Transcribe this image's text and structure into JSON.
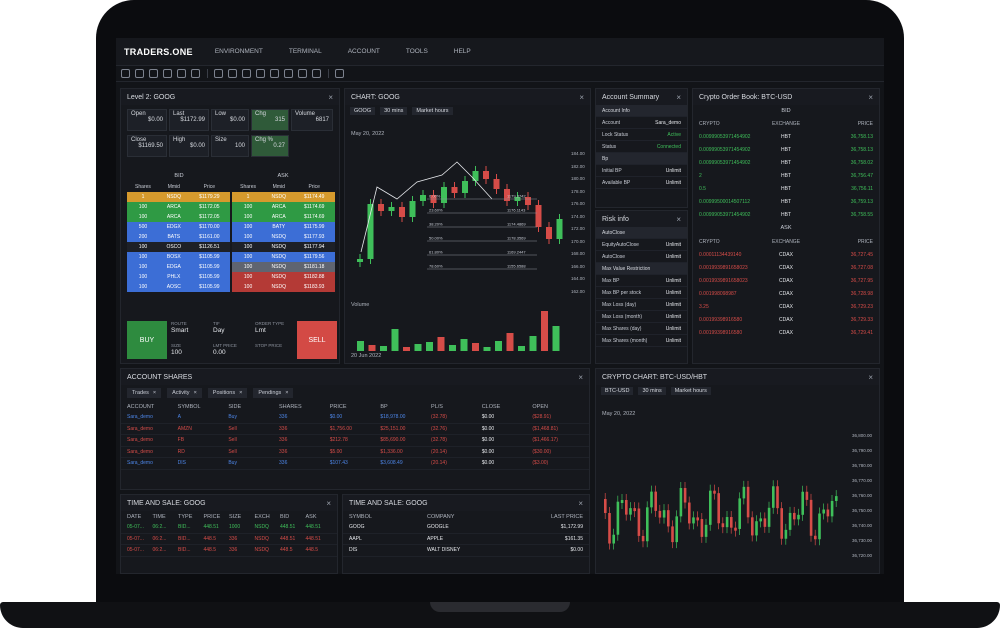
{
  "app": {
    "brand": "TRADERS.ONE",
    "nav": [
      "ENVIRONMENT",
      "TERMINAL",
      "ACCOUNT",
      "TOOLS",
      "HELP"
    ]
  },
  "level2": {
    "title": "Level 2: GOOG",
    "cells": [
      {
        "label": "Open",
        "value": "$0.00"
      },
      {
        "label": "Last",
        "value": "$1172.99"
      },
      {
        "label": "Low",
        "value": "$0.00"
      },
      {
        "label": "Chg",
        "value": "315"
      },
      {
        "label": "Volume",
        "value": "6817"
      },
      {
        "label": "Close",
        "value": "$1169.50"
      },
      {
        "label": "High",
        "value": "$0.00"
      },
      {
        "label": "Size",
        "value": "100"
      },
      {
        "label": "Chg %",
        "value": "0.27"
      }
    ],
    "bid_title": "BID",
    "ask_title": "ASK",
    "cols": [
      "Shares",
      "Mmid",
      "Price"
    ],
    "bids": [
      [
        "1",
        "NSDQ",
        "$1179.29",
        "orange"
      ],
      [
        "100",
        "ARCA",
        "$1172.05",
        "green"
      ],
      [
        "100",
        "ARCA",
        "$1172.05",
        "green"
      ],
      [
        "500",
        "EDGX",
        "$1170.00",
        "blue"
      ],
      [
        "200",
        "BATS",
        "$1161.00",
        "blue"
      ],
      [
        "100",
        "OSCO",
        "$1126.51",
        "dark"
      ],
      [
        "100",
        "BOSX",
        "$1105.99",
        "blue"
      ],
      [
        "100",
        "EDGA",
        "$1105.99",
        "blue"
      ],
      [
        "100",
        "PHLX",
        "$1105.99",
        "blue"
      ],
      [
        "100",
        "AOSC",
        "$1105.99",
        "blue"
      ]
    ],
    "asks": [
      [
        "1",
        "NSDQ",
        "$1174.49",
        "orange"
      ],
      [
        "100",
        "ARCA",
        "$1174.69",
        "green"
      ],
      [
        "100",
        "ARCA",
        "$1174.69",
        "green"
      ],
      [
        "100",
        "BATY",
        "$1175.99",
        "blue"
      ],
      [
        "100",
        "NSDQ",
        "$1177.93",
        "blue"
      ],
      [
        "100",
        "NSDQ",
        "$1177.94",
        "dark"
      ],
      [
        "100",
        "NSDQ",
        "$1179.56",
        "blue"
      ],
      [
        "100",
        "NSDQ",
        "$1181.18",
        "gray"
      ],
      [
        "100",
        "NSDQ",
        "$1182.88",
        "red"
      ],
      [
        "100",
        "NSDQ",
        "$1183.93",
        "red"
      ]
    ],
    "buy": "BUY",
    "sell": "SELL",
    "route_label": "ROUTE",
    "route": "Smart",
    "tif_label": "TIF",
    "tif": "Day",
    "order_label": "ORDER TYPE",
    "order": "Lmt",
    "size_label": "SIZE",
    "size": "100",
    "lmt_label": "LMT PRICE",
    "lmt": "0.00",
    "stop_label": "STOP PRICE",
    "stop": ""
  },
  "chart": {
    "title": "CHART: GOOG",
    "symbol": "GOOG",
    "interval": "30 mins",
    "session": "Market hours",
    "ohlc": "May 20, 2022",
    "volume_label": "Volume",
    "date": "20 Jun 2022",
    "price_ticks": [
      "184.00",
      "182.00",
      "180.00",
      "178.00",
      "176.00",
      "174.00",
      "172.00",
      "170.00",
      "168.00",
      "166.00",
      "164.00",
      "162.00"
    ],
    "fib": [
      [
        "0.00%",
        "1179.3742"
      ],
      [
        "23.60%",
        "1176.1143"
      ],
      [
        "38.20%",
        "1174.4869"
      ],
      [
        "50.00%",
        "1178.3569"
      ],
      [
        "61.80%",
        "1169.2447"
      ],
      [
        "78.60%",
        "1155.6588"
      ]
    ]
  },
  "summary": {
    "title": "Account Summary",
    "rows": [
      {
        "k": "Account Info",
        "v": "",
        "hdr": true
      },
      {
        "k": "Account",
        "v": "Sara_demo",
        "c": "white"
      },
      {
        "k": "Lock Status",
        "v": "Active",
        "c": "green"
      },
      {
        "k": "Status",
        "v": "Connected",
        "c": "green"
      },
      {
        "k": "Bp",
        "v": "",
        "hdr": true
      },
      {
        "k": "Initial BP",
        "v": "Unlimit",
        "c": "white"
      },
      {
        "k": "Available BP",
        "v": "Unlimit",
        "c": "white"
      }
    ]
  },
  "risk": {
    "title": "Risk info",
    "rows": [
      {
        "k": "AutoClose",
        "v": "",
        "hdr": true
      },
      {
        "k": "EquityAutoClose",
        "v": "Unlimit"
      },
      {
        "k": "AutoClose",
        "v": "Unlimit"
      },
      {
        "k": "Max Value Restriction",
        "v": "",
        "hdr": true
      },
      {
        "k": "Max BP",
        "v": "Unlimit"
      },
      {
        "k": "Max BP per stock",
        "v": "Unlimit"
      },
      {
        "k": "Max Loss (day)",
        "v": "Unlimit"
      },
      {
        "k": "Max Loss (month)",
        "v": "Unlimit"
      },
      {
        "k": "Max Shares (day)",
        "v": "Unlimit"
      },
      {
        "k": "Max Shares (month)",
        "v": "Unlimit"
      }
    ]
  },
  "orderbook": {
    "title": "Crypto Order Book: BTC-USD",
    "bid": "BID",
    "ask": "ASK",
    "cols": [
      "CRYPTO",
      "EXCHANGE",
      "PRICE"
    ],
    "bids": [
      [
        "0.00999053971454902",
        "HBT",
        "36,758.13"
      ],
      [
        "0.00999053971454902",
        "HBT",
        "36,758.13"
      ],
      [
        "0.00999053971454902",
        "HBT",
        "36,758.02"
      ],
      [
        "2",
        "HBT",
        "36,756.47"
      ],
      [
        "0.5",
        "HBT",
        "36,756.11"
      ],
      [
        "0.00999500014507112",
        "HBT",
        "36,759.13"
      ],
      [
        "0.00999053971454902",
        "HBT",
        "36,758.55"
      ]
    ],
    "asks": [
      [
        "0.00011134439140",
        "CDAX",
        "36,727.45"
      ],
      [
        "0.0019939891658023",
        "CDAX",
        "36,727.08"
      ],
      [
        "0.0019939891658023",
        "CDAX",
        "36,727.95"
      ],
      [
        "0.001998098987",
        "CDAX",
        "36,728.98"
      ],
      [
        "3.25",
        "CDAX",
        "36,729.23"
      ],
      [
        "0.00199398916580",
        "CDAX",
        "36,729.33"
      ],
      [
        "0.00199398916580",
        "CDAX",
        "36,729.41"
      ]
    ]
  },
  "shares": {
    "title": "ACCOUNT SHARES",
    "tabs": [
      "Trades",
      "Activity",
      "Positions",
      "Pendings"
    ],
    "cols": [
      "ACCOUNT",
      "SYMBOL",
      "SIDE",
      "SHARES",
      "PRICE",
      "BP",
      "PL/S",
      "CLOSE",
      "OPEN"
    ],
    "rows": [
      [
        "Sara_demo",
        "A",
        "Buy",
        "336",
        "$0.00",
        "$18,978.00",
        "(32.78)",
        "$0.00",
        "($28.91)",
        "blue"
      ],
      [
        "Sara_demo",
        "AMZN",
        "Sell",
        "336",
        "$1,756.00",
        "$25,151.00",
        "(32.76)",
        "$0.00",
        "($1,468.81)",
        "red"
      ],
      [
        "Sara_demo",
        "FB",
        "Sell",
        "336",
        "$212.78",
        "$85,690.00",
        "(32.78)",
        "$0.00",
        "($1,466.17)",
        "red"
      ],
      [
        "Sara_demo",
        "RD",
        "Sell",
        "336",
        "$5.00",
        "$1,336.00",
        "(20.14)",
        "$0.00",
        "($30.00)",
        "red"
      ],
      [
        "Sara_demo",
        "DIS",
        "Buy",
        "336",
        "$107.43",
        "$3,608.49",
        "(20.14)",
        "$0.00",
        "($3.00)",
        "blue"
      ]
    ]
  },
  "tns1": {
    "title": "TIME AND SALE: GOOG",
    "cols": [
      "DATE",
      "TIME",
      "TYPE",
      "PRICE",
      "SIZE",
      "EXCH",
      "BID",
      "ASK"
    ],
    "rows": [
      [
        "05-07...",
        "06:2...",
        "BID...",
        "448.51",
        "1000",
        "NSDQ",
        "448.51",
        "448.51",
        "green"
      ],
      [
        "05-07...",
        "06:2...",
        "BID...",
        "448.5",
        "336",
        "NSDQ",
        "448.51",
        "448.51",
        "red"
      ],
      [
        "05-07...",
        "06:2...",
        "BID...",
        "448.5",
        "336",
        "NSDQ",
        "448.5",
        "448.5",
        "red"
      ]
    ]
  },
  "tns2": {
    "title": "TIME AND SALE: GOOG",
    "cols": [
      "SYMBOL",
      "COMPANY",
      "LAST PRICE"
    ],
    "rows": [
      [
        "GOOG",
        "GOOGLE",
        "$1,172.99"
      ],
      [
        "AAPL",
        "APPLE",
        "$161.35"
      ],
      [
        "DIS",
        "WALT DISNEY",
        "$0.00"
      ]
    ]
  },
  "crypto": {
    "title": "CRYPTO CHART: BTC-USD/HBT",
    "symbol": "BTC-USD",
    "interval": "30 mins",
    "session": "Market hours",
    "ohlc": "May 20, 2022",
    "price_ticks": [
      "36,800.00",
      "36,790.00",
      "36,780.00",
      "36,770.00",
      "36,760.00",
      "36,750.00",
      "36,740.00",
      "36,730.00",
      "36,720.00"
    ]
  }
}
